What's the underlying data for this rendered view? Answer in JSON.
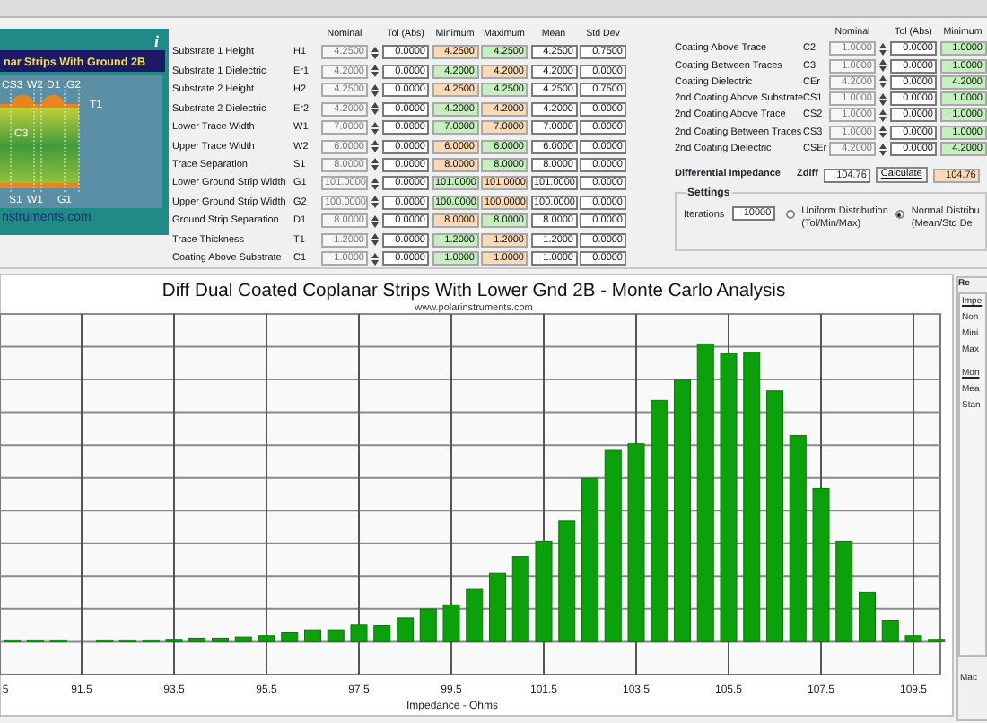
{
  "diagram": {
    "title": "nar Strips With Ground 2B",
    "info": "i",
    "labels": [
      "CS3",
      "W2",
      "D1",
      "G2",
      "T1",
      "C3",
      "S1",
      "W1",
      "G1"
    ],
    "footer": "nstruments.com"
  },
  "structure_params": {
    "columns": [
      "Nominal",
      "Tol (Abs)",
      "Minimum",
      "Maximum",
      "Mean",
      "Std Dev"
    ],
    "rows": [
      {
        "label": "Substrate 1 Height",
        "symbol": "H1",
        "nominal": "4.2500",
        "tol": "0.0000",
        "minimum": {
          "value": "4.2500",
          "color": "#fbd8b6"
        },
        "maximum": {
          "value": "4.2500",
          "color": "#c6efbf"
        },
        "mean": "4.2500",
        "std_dev": "0.7500"
      },
      {
        "label": "Substrate 1 Dielectric",
        "symbol": "Er1",
        "nominal": "4.2000",
        "tol": "0.0000",
        "minimum": {
          "value": "4.2000",
          "color": "#c6efbf"
        },
        "maximum": {
          "value": "4.2000",
          "color": "#fbd8b6"
        },
        "mean": "4.2000",
        "std_dev": "0.0000"
      },
      {
        "label": "Substrate 2 Height",
        "symbol": "H2",
        "nominal": "4.2500",
        "tol": "0.0000",
        "minimum": {
          "value": "4.2500",
          "color": "#fbd8b6"
        },
        "maximum": {
          "value": "4.2500",
          "color": "#c6efbf"
        },
        "mean": "4.2500",
        "std_dev": "0.7500"
      },
      {
        "label": "Substrate 2 Dielectric",
        "symbol": "Er2",
        "nominal": "4.2000",
        "tol": "0.0000",
        "minimum": {
          "value": "4.2000",
          "color": "#c6efbf"
        },
        "maximum": {
          "value": "4.2000",
          "color": "#fbd8b6"
        },
        "mean": "4.2000",
        "std_dev": "0.0000"
      },
      {
        "label": "Lower Trace Width",
        "symbol": "W1",
        "nominal": "7.0000",
        "tol": "0.0000",
        "minimum": {
          "value": "7.0000",
          "color": "#c6efbf"
        },
        "maximum": {
          "value": "7.0000",
          "color": "#fbd8b6"
        },
        "mean": "7.0000",
        "std_dev": "0.0000"
      },
      {
        "label": "Upper Trace Width",
        "symbol": "W2",
        "nominal": "6.0000",
        "tol": "0.0000",
        "minimum": {
          "value": "6.0000",
          "color": "#fbd8b6"
        },
        "maximum": {
          "value": "6.0000",
          "color": "#c6efbf"
        },
        "mean": "6.0000",
        "std_dev": "0.0000"
      },
      {
        "label": "Trace Separation",
        "symbol": "S1",
        "nominal": "8.0000",
        "tol": "0.0000",
        "minimum": {
          "value": "8.0000",
          "color": "#fbd8b6"
        },
        "maximum": {
          "value": "8.0000",
          "color": "#c6efbf"
        },
        "mean": "8.0000",
        "std_dev": "0.0000"
      },
      {
        "label": "Lower Ground Strip Width",
        "symbol": "G1",
        "nominal": "101.0000",
        "tol": "0.0000",
        "minimum": {
          "value": "101.0000",
          "color": "#c6efbf"
        },
        "maximum": {
          "value": "101.0000",
          "color": "#fbd8b6"
        },
        "mean": "101.0000",
        "std_dev": "0.0000"
      },
      {
        "label": "Upper Ground Strip Width",
        "symbol": "G2",
        "nominal": "100.0000",
        "tol": "0.0000",
        "minimum": {
          "value": "100.0000",
          "color": "#c6efbf"
        },
        "maximum": {
          "value": "100.0000",
          "color": "#fbd8b6"
        },
        "mean": "100.0000",
        "std_dev": "0.0000"
      },
      {
        "label": "Ground Strip Separation",
        "symbol": "D1",
        "nominal": "8.0000",
        "tol": "0.0000",
        "minimum": {
          "value": "8.0000",
          "color": "#fbd8b6"
        },
        "maximum": {
          "value": "8.0000",
          "color": "#c6efbf"
        },
        "mean": "8.0000",
        "std_dev": "0.0000"
      },
      {
        "label": "Trace Thickness",
        "symbol": "T1",
        "nominal": "1.2000",
        "tol": "0.0000",
        "minimum": {
          "value": "1.2000",
          "color": "#c6efbf"
        },
        "maximum": {
          "value": "1.2000",
          "color": "#fbd8b6"
        },
        "mean": "1.2000",
        "std_dev": "0.0000"
      },
      {
        "label": "Coating Above Substrate",
        "symbol": "C1",
        "nominal": "1.0000",
        "tol": "0.0000",
        "minimum": {
          "value": "1.0000",
          "color": "#c6efbf"
        },
        "maximum": {
          "value": "1.0000",
          "color": "#fbd8b6"
        },
        "mean": "1.0000",
        "std_dev": "0.0000"
      }
    ]
  },
  "coating_params": {
    "columns": [
      "Nominal",
      "Tol (Abs)",
      "Minimum"
    ],
    "rows": [
      {
        "label": "Coating Above Trace",
        "symbol": "C2",
        "nominal": "1.0000",
        "tol": "0.0000",
        "minimum": {
          "value": "1.0000",
          "color": "#c6efbf"
        }
      },
      {
        "label": "Coating Between Traces",
        "symbol": "C3",
        "nominal": "1.0000",
        "tol": "0.0000",
        "minimum": {
          "value": "1.0000",
          "color": "#c6efbf"
        }
      },
      {
        "label": "Coating Dielectric",
        "symbol": "CEr",
        "nominal": "4.2000",
        "tol": "0.0000",
        "minimum": {
          "value": "4.2000",
          "color": "#c6efbf"
        }
      },
      {
        "label": "2nd Coating Above Substrate",
        "symbol": "CS1",
        "nominal": "1.0000",
        "tol": "0.0000",
        "minimum": {
          "value": "1.0000",
          "color": "#c6efbf"
        }
      },
      {
        "label": "2nd Coating Above Trace",
        "symbol": "CS2",
        "nominal": "1.0000",
        "tol": "0.0000",
        "minimum": {
          "value": "1.0000",
          "color": "#c6efbf"
        }
      },
      {
        "label": "2nd Coating Between Traces",
        "symbol": "CS3",
        "nominal": "1.0000",
        "tol": "0.0000",
        "minimum": {
          "value": "1.0000",
          "color": "#c6efbf"
        }
      },
      {
        "label": "2nd Coating Dielectric",
        "symbol": "CSEr",
        "nominal": "4.2000",
        "tol": "0.0000",
        "minimum": {
          "value": "4.2000",
          "color": "#c6efbf"
        }
      }
    ]
  },
  "differential_impedance": {
    "label": "Differential Impedance",
    "symbol": "Zdiff",
    "value": "104.76",
    "button": "Calculate",
    "result": {
      "value": "104.76",
      "color": "#fbd8b6"
    }
  },
  "settings": {
    "title": "Settings",
    "iterations_label": "Iterations",
    "iterations": "10000",
    "distributions": [
      {
        "label": "Uniform Distribution",
        "sublabel": "(Tol/Min/Max)",
        "selected": false
      },
      {
        "label": "Normal Distribu",
        "sublabel": "(Mean/Std De",
        "selected": true
      }
    ]
  },
  "chart": {
    "title": "Diff Dual Coated Coplanar Strips With Lower Gnd 2B - Monte Carlo Analysis",
    "subtitle": "www.polarinstruments.com",
    "xtick_labels": [
      "5",
      "91.5",
      "93.5",
      "95.5",
      "97.5",
      "99.5",
      "101.5",
      "103.5",
      "105.5",
      "107.5",
      "109.5"
    ],
    "xlabel": "Impedance - Ohms"
  },
  "results_panel": {
    "heading": "Re",
    "items": [
      {
        "text": "Impe",
        "kind": "section"
      },
      {
        "text": "Non",
        "kind": "item"
      },
      {
        "text": "Mini",
        "kind": "item"
      },
      {
        "text": "Max",
        "kind": "item"
      },
      {
        "text": "Mon",
        "kind": "section"
      },
      {
        "text": "Mea",
        "kind": "item"
      },
      {
        "text": "Stan",
        "kind": "item"
      }
    ],
    "footer": "Mac"
  }
}
